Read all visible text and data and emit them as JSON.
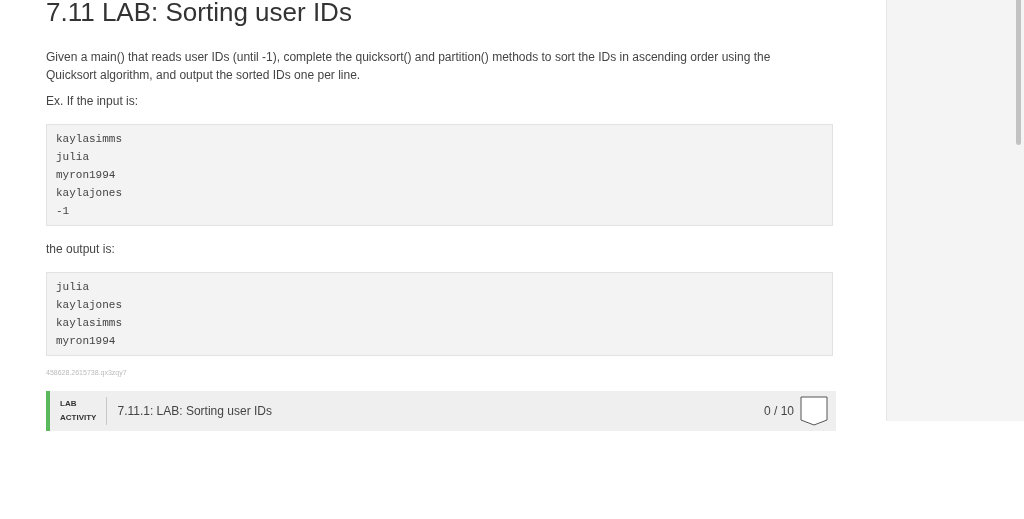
{
  "title": "7.11 LAB: Sorting user IDs",
  "description": "Given a main() that reads user IDs (until -1), complete the quicksort() and partition() methods to sort the IDs in ascending order using the Quicksort algorithm, and output the sorted IDs one per line.",
  "input_label": "Ex. If the input is:",
  "input_lines": [
    "kaylasimms",
    "julia",
    "myron1994",
    "kaylajones",
    "-1"
  ],
  "output_label": "the output is:",
  "output_lines": [
    "julia",
    "kaylajones",
    "kaylasimms",
    "myron1994"
  ],
  "hash": "458628.2615738.qx3zqy7",
  "lab_activity": {
    "tag_lines": [
      "LAB",
      "ACTIVITY"
    ],
    "title": "7.11.1: LAB: Sorting user IDs",
    "score": "0 / 10"
  }
}
